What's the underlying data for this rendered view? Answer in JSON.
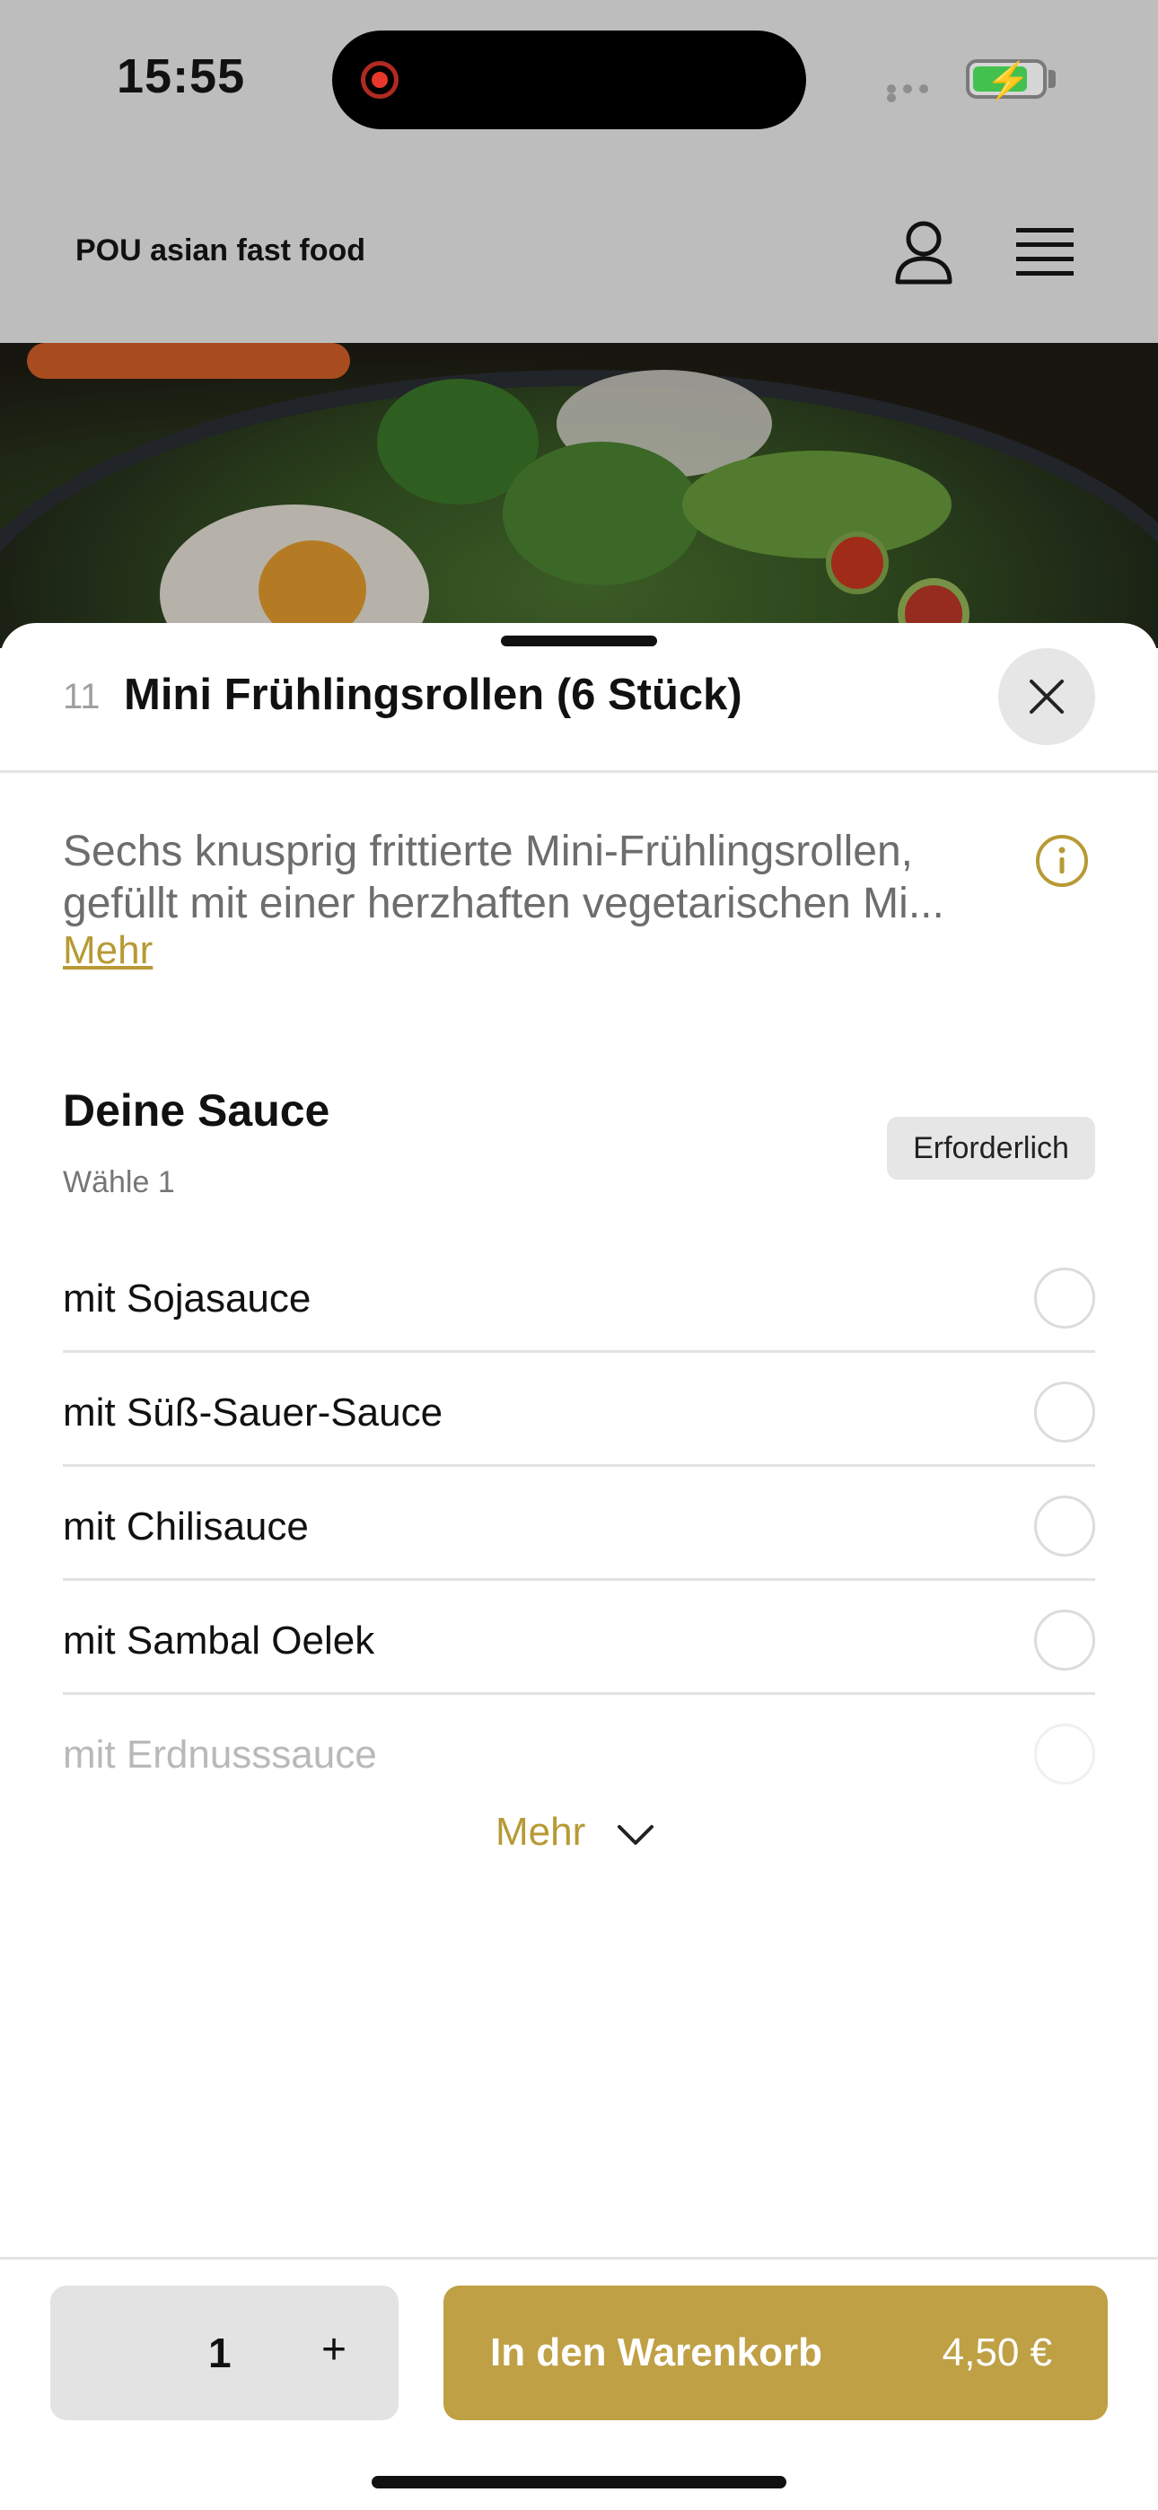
{
  "status_bar": {
    "time": "15:55"
  },
  "header": {
    "title": "POU asian fast food",
    "icons": [
      "user-icon",
      "menu-icon"
    ]
  },
  "item": {
    "number": "11",
    "title": "Mini Frühlingsrollen (6 Stück)",
    "description": "Sechs knusprig frittierte Mini-Frühlingsrollen, gefüllt mit einer herzhaften vegetarischen Mi...",
    "more_label": "Mehr"
  },
  "sauce_group": {
    "title": "Deine Sauce",
    "subtitle": "Wähle 1",
    "badge": "Erforderlich",
    "options": [
      {
        "label": "mit Sojasauce"
      },
      {
        "label": "mit Süß-Sauer-Sauce"
      },
      {
        "label": "mit Chilisauce"
      },
      {
        "label": "mit Sambal Oelek"
      },
      {
        "label": "mit Erdnusssauce"
      }
    ],
    "show_more": "Mehr"
  },
  "footer": {
    "quantity": "1",
    "plus": "+",
    "add_to_cart": "In den Warenkorb",
    "price": "4,50 €"
  },
  "colors": {
    "accent": "#bfa045",
    "overlay": "#bdbdbd"
  }
}
